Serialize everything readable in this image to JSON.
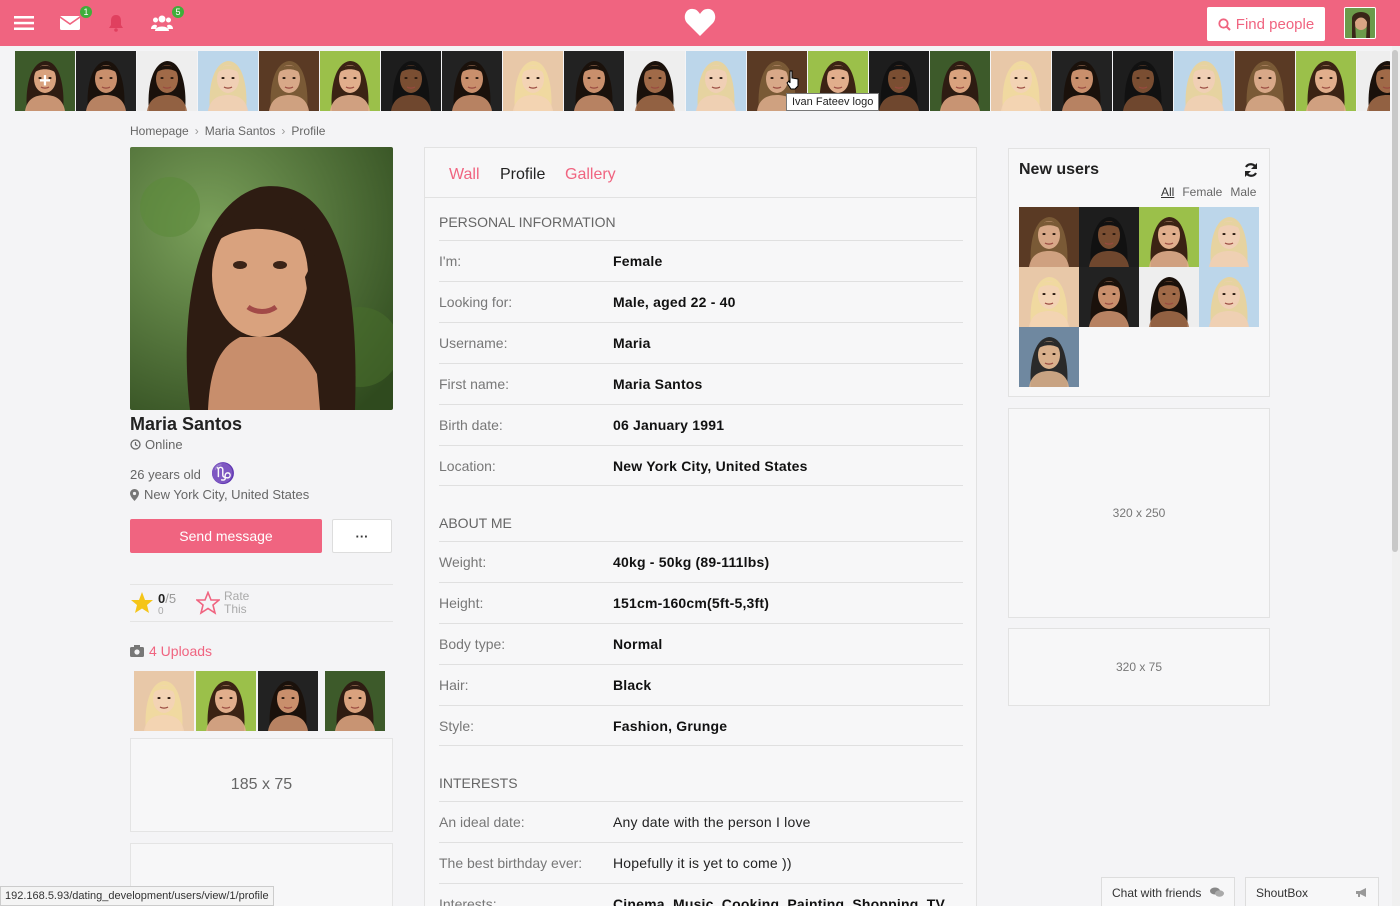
{
  "topbar": {
    "messages_badge": "1",
    "friends_badge": "5",
    "find_label": "Find people"
  },
  "tooltip": "Ivan Fateev logo",
  "breadcrumb": [
    "Homepage",
    "Maria Santos",
    "Profile"
  ],
  "profile": {
    "name": "Maria Santos",
    "status": "Online",
    "age": "26 years old",
    "zodiac": "♑",
    "location": "New York City, United States",
    "send_label": "Send message",
    "more_label": "···",
    "rating": "0",
    "rating_max": "/5",
    "rating_count": "0",
    "rate_this": "Rate This",
    "uploads_label": "4 Uploads",
    "ad_label": "185 x 75"
  },
  "tabs": [
    "Wall",
    "Profile",
    "Gallery"
  ],
  "sections": {
    "personal": {
      "title": "PERSONAL INFORMATION",
      "rows": [
        {
          "label": "I'm:",
          "value": "Female"
        },
        {
          "label": "Looking for:",
          "value": "Male, aged 22 - 40"
        },
        {
          "label": "Username:",
          "value": "Maria"
        },
        {
          "label": "First name:",
          "value": "Maria Santos"
        },
        {
          "label": "Birth date:",
          "value": "06 January 1991"
        },
        {
          "label": "Location:",
          "value": "New York City, United States"
        }
      ]
    },
    "about": {
      "title": "ABOUT ME",
      "rows": [
        {
          "label": "Weight:",
          "value": "40kg - 50kg (89-111lbs)"
        },
        {
          "label": "Height:",
          "value": "151cm-160cm(5ft-5,3ft)"
        },
        {
          "label": "Body type:",
          "value": "Normal"
        },
        {
          "label": "Hair:",
          "value": "Black"
        },
        {
          "label": "Style:",
          "value": "Fashion, Grunge"
        }
      ]
    },
    "interests": {
      "title": "INTERESTS",
      "rows": [
        {
          "label": "An ideal date:",
          "value": "Any date with the person I love"
        },
        {
          "label": "The best birthday ever:",
          "value": "Hopefully it is yet to come ))"
        },
        {
          "label": "Interests:",
          "value": "Cinema, Music, Cooking, Painting, Shopping, TV"
        }
      ]
    }
  },
  "new_users": {
    "title": "New users",
    "filters": [
      "All",
      "Female",
      "Male"
    ]
  },
  "ads": {
    "right1": "320 x 250",
    "right2": "320 x 75"
  },
  "chat": {
    "friends": "Chat with friends",
    "shoutbox": "ShoutBox"
  },
  "status_url": "192.168.5.93/dating_development/users/view/1/profile",
  "colors": {
    "accent": "#f06480",
    "badge": "#3fae3a"
  }
}
